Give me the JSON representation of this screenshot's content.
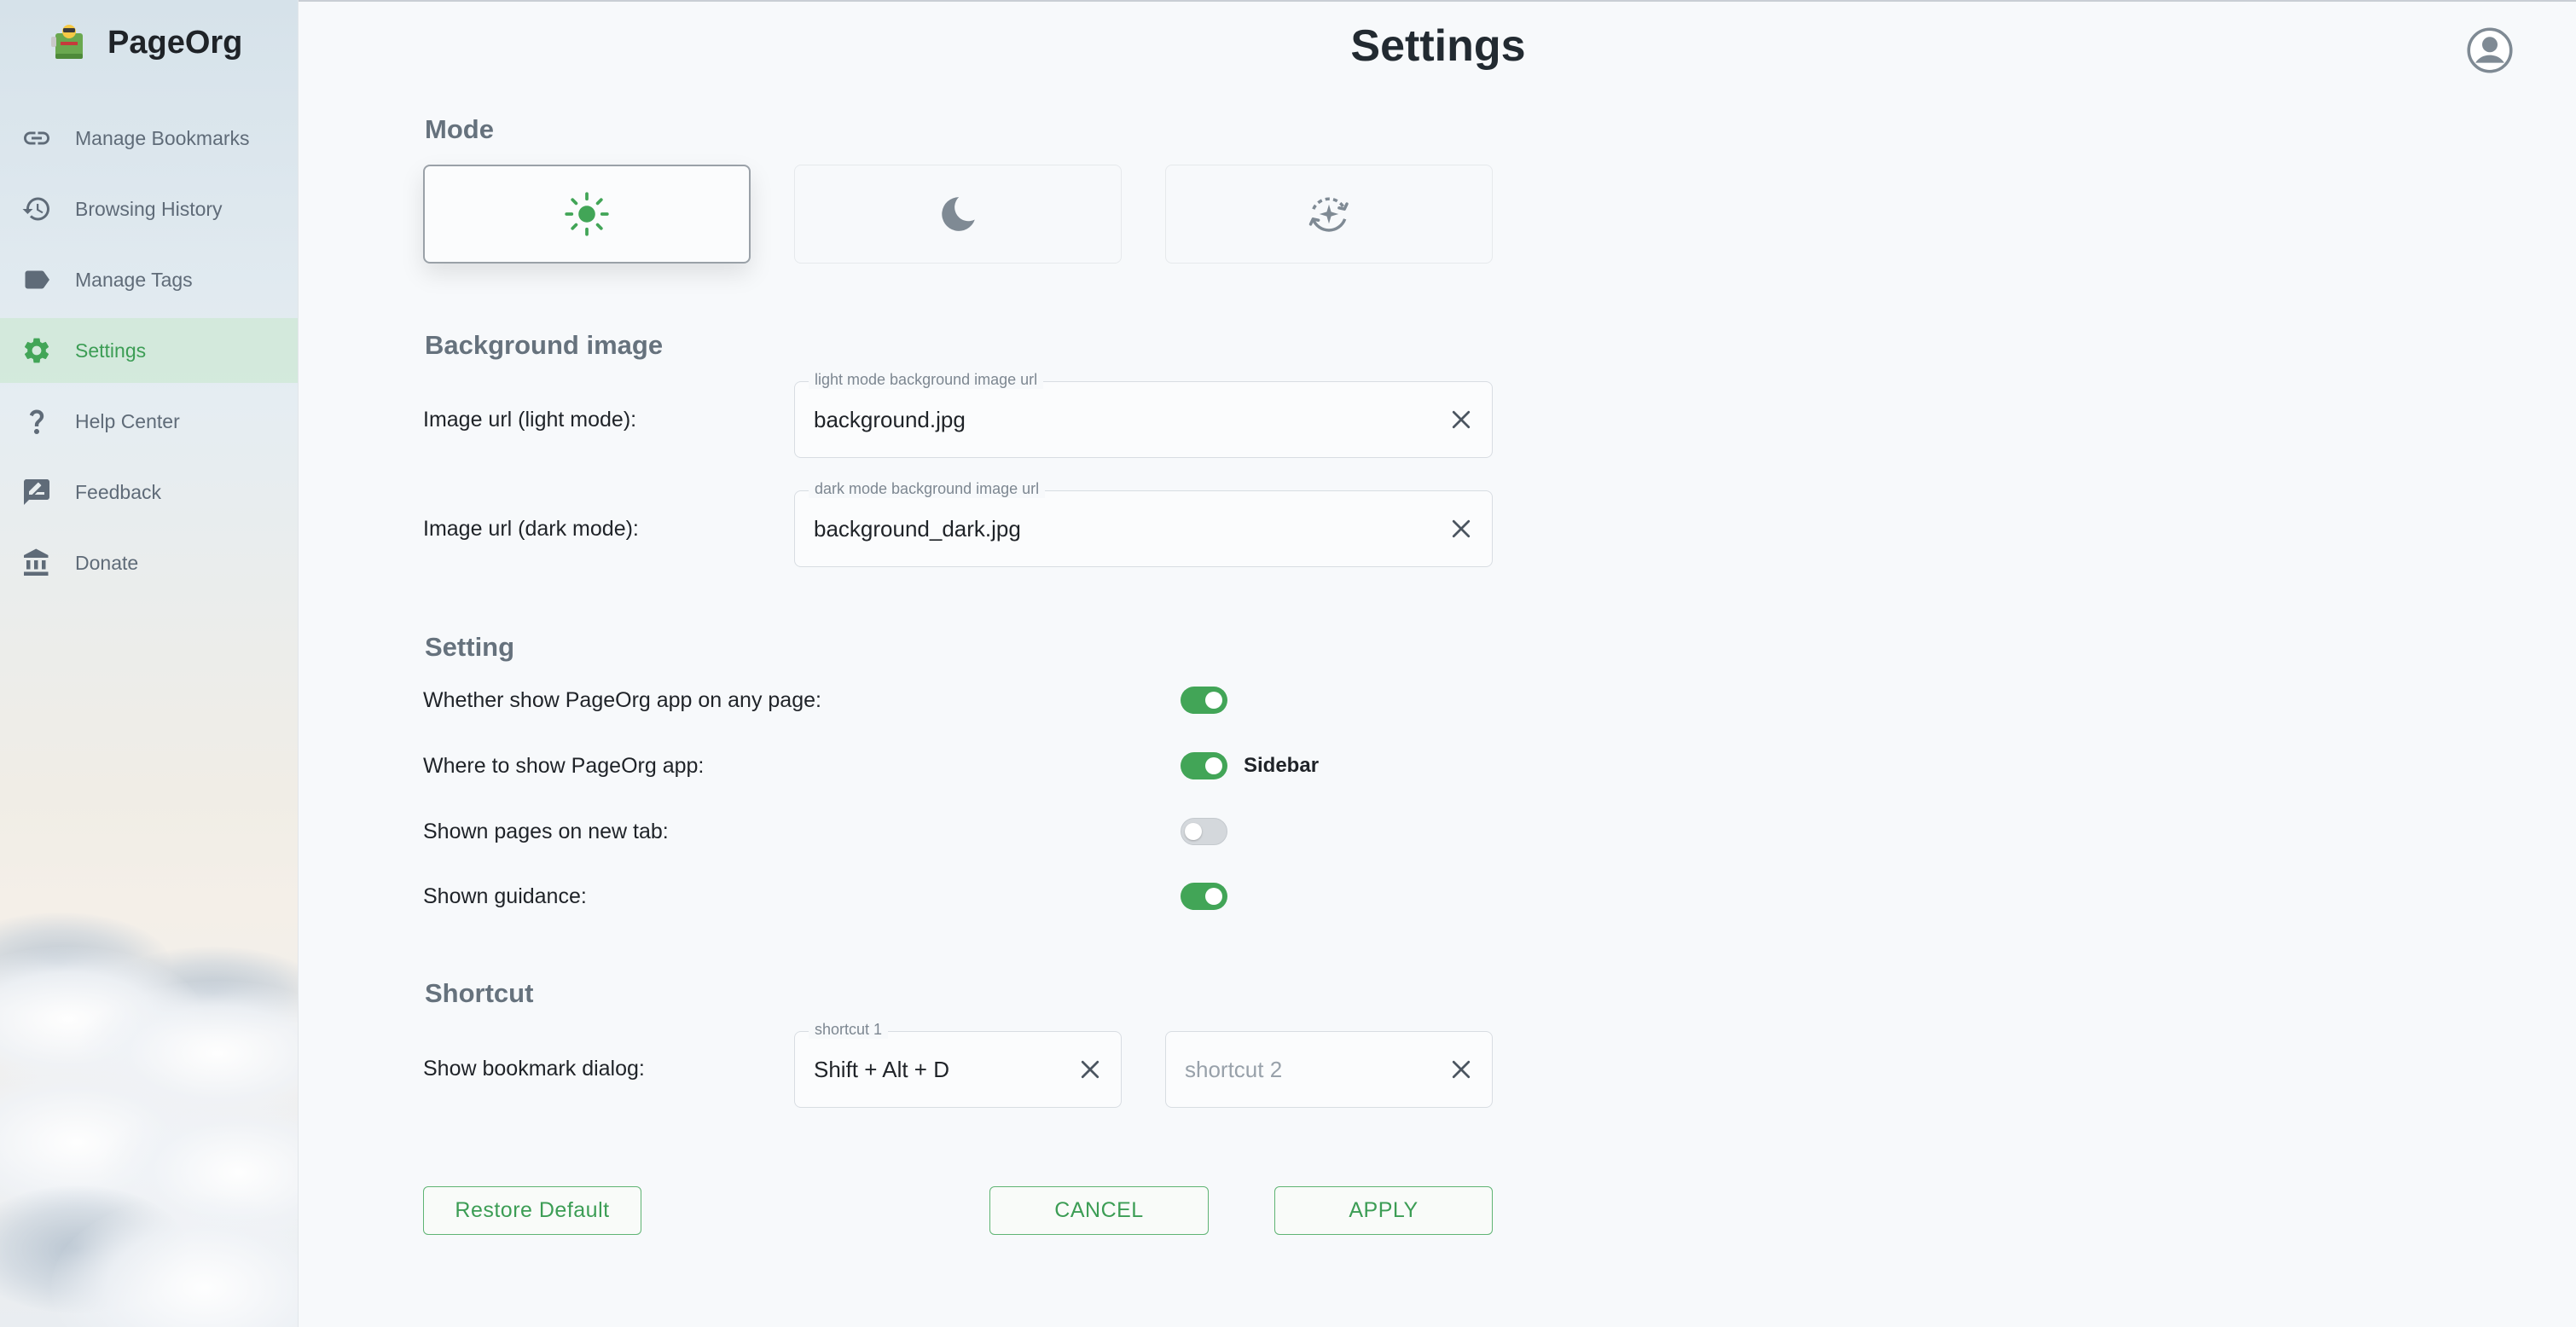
{
  "app": {
    "name": "PageOrg"
  },
  "header": {
    "title": "Settings"
  },
  "sidebar": {
    "items": [
      {
        "label": "Manage Bookmarks",
        "icon": "link-icon"
      },
      {
        "label": "Browsing History",
        "icon": "history-icon"
      },
      {
        "label": "Manage Tags",
        "icon": "tag-icon"
      },
      {
        "label": "Settings",
        "icon": "gear-icon",
        "active": true
      },
      {
        "label": "Help Center",
        "icon": "question-icon"
      },
      {
        "label": "Feedback",
        "icon": "feedback-icon"
      },
      {
        "label": "Donate",
        "icon": "bank-icon"
      }
    ]
  },
  "mode": {
    "title": "Mode",
    "options": [
      {
        "icon": "sun-icon",
        "selected": true
      },
      {
        "icon": "moon-icon",
        "selected": false
      },
      {
        "icon": "auto-mode-icon",
        "selected": false
      }
    ]
  },
  "background": {
    "title": "Background image",
    "light": {
      "label": "Image url (light mode):",
      "legend": "light mode background image url",
      "value": "background.jpg"
    },
    "dark": {
      "label": "Image url (dark mode):",
      "legend": "dark mode background image url",
      "value": "background_dark.jpg"
    }
  },
  "setting": {
    "title": "Setting",
    "rows": [
      {
        "label": "Whether show PageOrg app on any page:",
        "on": true
      },
      {
        "label": "Where to show PageOrg app:",
        "on": true,
        "value": "Sidebar"
      },
      {
        "label": "Shown pages on new tab:",
        "on": false
      },
      {
        "label": "Shown guidance:",
        "on": true
      }
    ]
  },
  "shortcut": {
    "title": "Shortcut",
    "row_label": "Show bookmark dialog:",
    "shortcut1": {
      "legend": "shortcut 1",
      "value": "Shift + Alt + D"
    },
    "shortcut2": {
      "placeholder": "shortcut 2"
    }
  },
  "actions": {
    "restore": "Restore Default",
    "cancel": "CANCEL",
    "apply": "APPLY"
  },
  "colors": {
    "accent": "#42a557",
    "muted": "#66727d",
    "active_bg": "#cee8d4"
  }
}
